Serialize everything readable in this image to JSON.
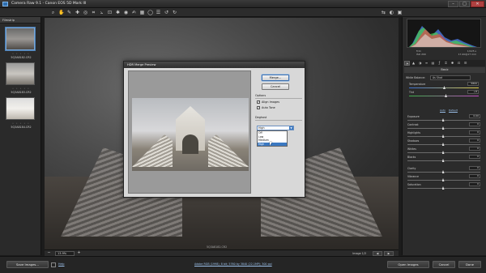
{
  "window": {
    "title": "Camera Raw 9.1  -  Canon EOS 5D Mark III",
    "minimize": "–",
    "maximize": "□",
    "close": "✕"
  },
  "toolbar": {
    "tools": [
      "zoom-icon",
      "hand-icon",
      "white-balance-icon",
      "color-sampler-icon",
      "target-adjust-icon",
      "crop-icon",
      "straighten-icon",
      "transform-icon",
      "spot-removal-icon",
      "red-eye-icon",
      "adjustment-brush-icon",
      "graduated-filter-icon",
      "radial-filter-icon",
      "preferences-icon",
      "rotate-left-icon",
      "rotate-right-icon"
    ],
    "tool_glyphs": [
      "⌕",
      "✋",
      "✎",
      "✚",
      "◎",
      "⌗",
      "⦣",
      "⊡",
      "✱",
      "◉",
      "✍",
      "▦",
      "◯",
      "☰",
      "↺",
      "↻"
    ],
    "right_glyphs": [
      "⇆",
      "◐",
      "▣"
    ]
  },
  "filmstrip": {
    "header": "Filmstrip",
    "items": [
      {
        "label": "5Q3A8182.CR2",
        "stars": "• • • • •",
        "selected": true
      },
      {
        "label": "5Q3A8183.CR2",
        "stars": "• • • • •",
        "selected": false
      },
      {
        "label": "5Q3A8184.CR2",
        "stars": "• • • • •",
        "selected": false
      }
    ]
  },
  "preview": {
    "filename": "5Q3A8182.CR2",
    "zoom": "13.9%",
    "zoom_minus": "−",
    "zoom_plus": "+",
    "count": "Image 1/3",
    "prev": "◀",
    "next": "▶"
  },
  "histogram": {
    "exif_rows": [
      [
        "f/11",
        "1/125 s"
      ],
      [
        "ISO 200",
        "17-40@17 mm"
      ]
    ],
    "colors": {
      "red": "#e04a4a",
      "green": "#4ad04a",
      "blue": "#4a7ae0"
    }
  },
  "panel": {
    "tabs": [
      "◔",
      "▲",
      "◑",
      "≡",
      "▤",
      "ƒ",
      "⌗",
      "✱",
      "⊡",
      "☰"
    ],
    "section_title": "Basic",
    "wb_label": "White Balance:",
    "wb_value": "As Shot",
    "temp_label": "Temperature",
    "temp_value": "5800",
    "tint_label": "Tint",
    "tint_value": "+8",
    "auto_link": "Auto",
    "default_link": "Default",
    "sliders": [
      {
        "label": "Exposure",
        "value": "0.00",
        "pos": 0.5
      },
      {
        "label": "Contrast",
        "value": "0",
        "pos": 0.5
      },
      {
        "label": "Highlights",
        "value": "0",
        "pos": 0.5
      },
      {
        "label": "Shadows",
        "value": "0",
        "pos": 0.5
      },
      {
        "label": "Whites",
        "value": "0",
        "pos": 0.5
      },
      {
        "label": "Blacks",
        "value": "0",
        "pos": 0.5
      },
      {
        "label": "Clarity",
        "value": "0",
        "pos": 0.5
      },
      {
        "label": "Vibrance",
        "value": "0",
        "pos": 0.5
      },
      {
        "label": "Saturation",
        "value": "0",
        "pos": 0.5
      }
    ]
  },
  "dialog": {
    "title": "HDR Merge Preview",
    "merge_button": "Merge...",
    "cancel_button": "Cancel",
    "options_label": "Options",
    "align_label": "Align Images",
    "autotone_label": "Auto Tone",
    "deghost_label": "Deghost",
    "deghost_value": "High",
    "deghost_arrow": "▼",
    "deghost_options": [
      "Off",
      "Low",
      "Medium",
      "High"
    ],
    "deghost_highlighted": 3,
    "check_mark": "✓"
  },
  "bottom": {
    "save_button": "Save Images...",
    "help_link": "Help",
    "workflow_info": "Adobe RGB (1998); 8 bit; 5760 by 3840 (22.1MP); 300 ppi",
    "open_button": "Open Images",
    "cancel_button": "Cancel",
    "done_button": "Done"
  }
}
